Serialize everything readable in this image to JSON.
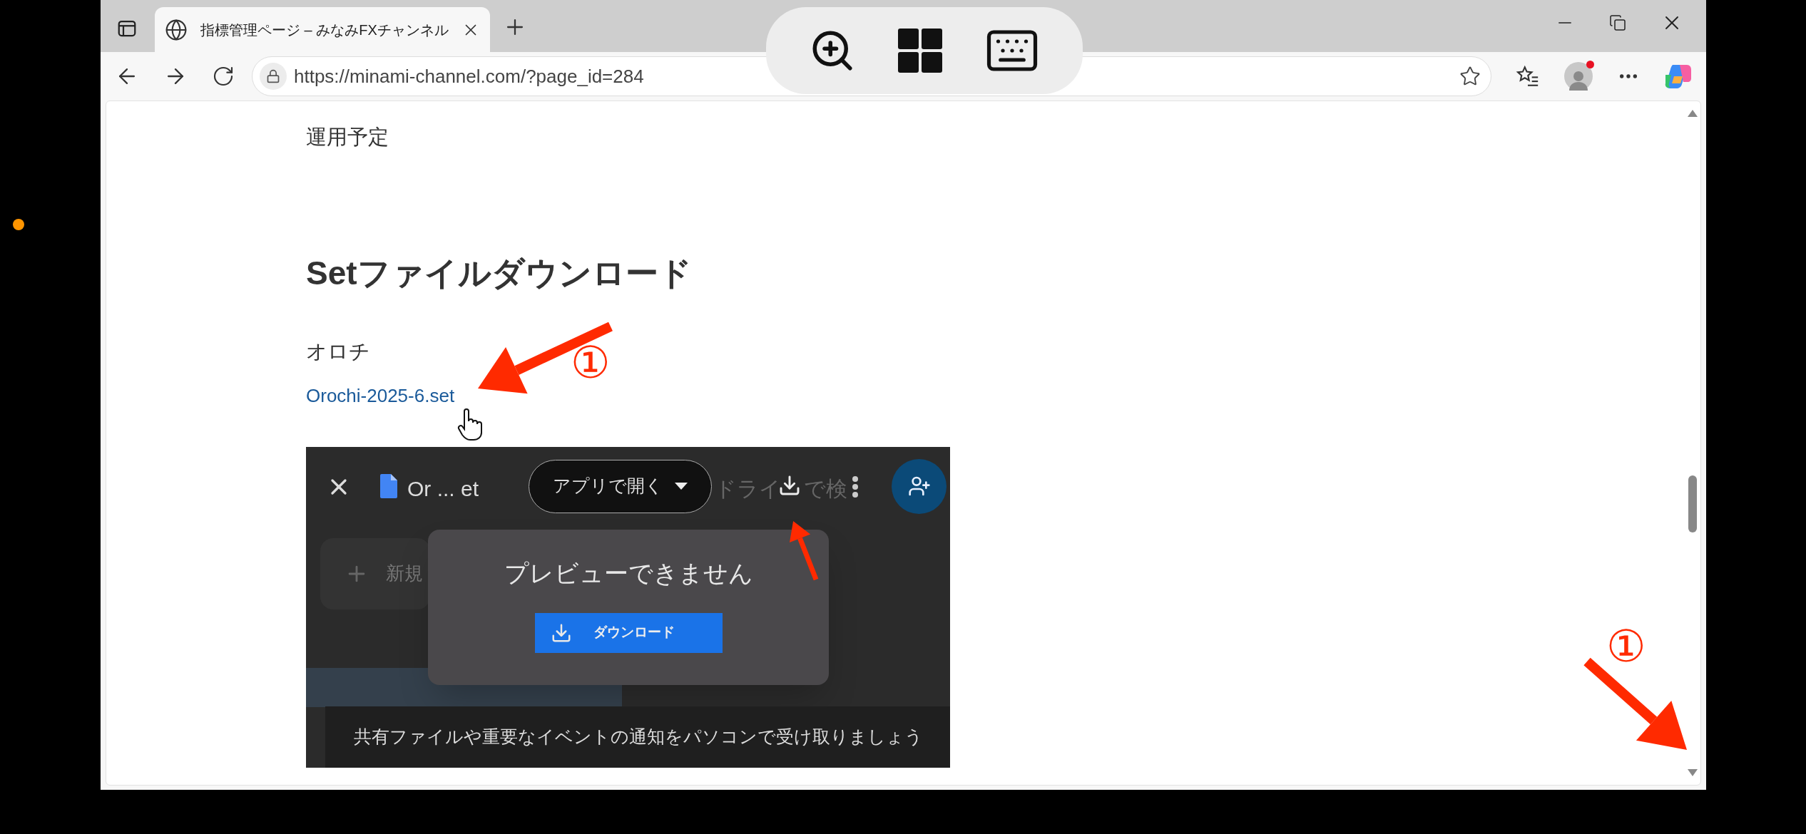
{
  "browser": {
    "tabs": [
      {
        "title": "指標管理ページ – みなみFXチャンネル",
        "selected": true
      }
    ],
    "address": "https://minami-channel.com/?page_id=284",
    "profile_notification": true
  },
  "page": {
    "paragraph": "運用予定",
    "heading": "Setファイルダウンロード",
    "item_label": "オロチ",
    "file_link": "Orochi-2025-6.set"
  },
  "embedded_screenshot": {
    "file_name": "Or ... et",
    "open_with_button": "アプリで開く",
    "search_fragments": [
      "ドライ",
      "で検"
    ],
    "new_button": "新規",
    "dialog": {
      "title": "プレビューできません",
      "download_button": "ダウンロード"
    },
    "notification": "共有ファイルや重要なイベントの通知をパソコンで受け取りましょう"
  },
  "annotations": [
    {
      "label": "①"
    },
    {
      "label": "①"
    }
  ]
}
